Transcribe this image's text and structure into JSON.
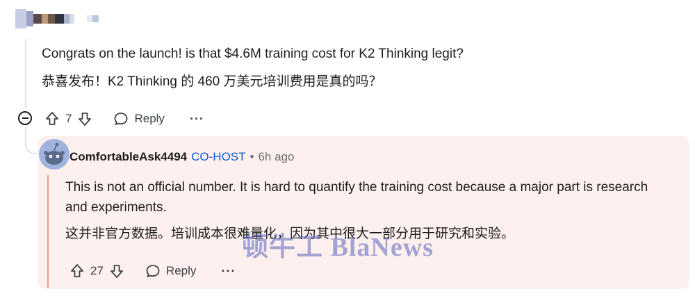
{
  "parent_comment": {
    "text_en": "Congrats on the launch! is that $4.6M training cost for K2 Thinking legit?",
    "text_zh": "恭喜发布！K2 Thinking 的 460 万美元培训费用是真的吗？",
    "votes": "7",
    "reply_label": "Reply",
    "more_label": "···"
  },
  "reply_comment": {
    "username": "ComfortableAsk4494",
    "role_badge": "CO-HOST",
    "separator": "•",
    "time": "6h ago",
    "text_en_line1": "This is not an official number. It is hard to quantify the training cost because a major part is research",
    "text_en_line2": "and experiments.",
    "text_zh": "这并非官方数据。培训成本很难量化，因为其中很大一部分用于研究和实验。",
    "votes": "27",
    "reply_label": "Reply",
    "more_label": "···"
  },
  "watermark_text": "顿牛工 BlaNews",
  "icons": {
    "upvote": "arrow-up-icon",
    "downvote": "arrow-down-icon",
    "reply": "chat-bubble-icon",
    "collapse": "minus-circle-icon",
    "avatar": "reddit-snoo-avatar"
  },
  "colors": {
    "highlight_bg": "#fdf0ee",
    "highlight_line": "#f0a07a",
    "cohost": "#0a5bd3",
    "meta": "#6a6f73"
  }
}
